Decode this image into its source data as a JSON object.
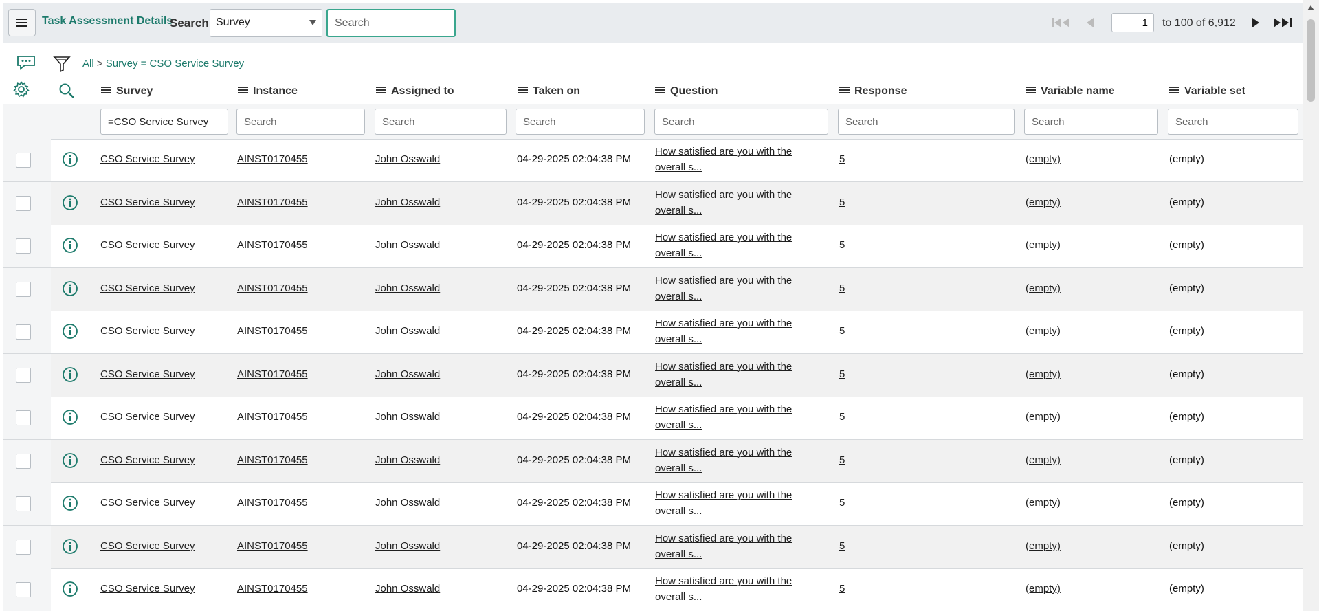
{
  "header": {
    "title": "Task Assessment Details",
    "search_label": "Search",
    "search_field": "Survey",
    "search_placeholder": "Search"
  },
  "pager": {
    "current_page": "1",
    "range_text": "to 100 of 6,912"
  },
  "breadcrumb": {
    "all": "All",
    "separator": ">",
    "condition": "Survey = CSO Service Survey"
  },
  "columns": [
    "Survey",
    "Instance",
    "Assigned to",
    "Taken on",
    "Question",
    "Response",
    "Variable name",
    "Variable set"
  ],
  "filters": [
    "=CSO Service Survey",
    "",
    "",
    "",
    "",
    "",
    "",
    ""
  ],
  "filter_placeholder": "Search",
  "rows": [
    {
      "survey": "CSO Service Survey",
      "instance": "AINST0170455",
      "assigned_to": "John Osswald",
      "taken_on": "04-29-2025 02:04:38 PM",
      "question": "How satisfied are you with the overall s...",
      "response": "5",
      "variable_name": "(empty)",
      "variable_set": "(empty)"
    },
    {
      "survey": "CSO Service Survey",
      "instance": "AINST0170455",
      "assigned_to": "John Osswald",
      "taken_on": "04-29-2025 02:04:38 PM",
      "question": "How satisfied are you with the overall s...",
      "response": "5",
      "variable_name": "(empty)",
      "variable_set": "(empty)"
    },
    {
      "survey": "CSO Service Survey",
      "instance": "AINST0170455",
      "assigned_to": "John Osswald",
      "taken_on": "04-29-2025 02:04:38 PM",
      "question": "How satisfied are you with the overall s...",
      "response": "5",
      "variable_name": "(empty)",
      "variable_set": "(empty)"
    },
    {
      "survey": "CSO Service Survey",
      "instance": "AINST0170455",
      "assigned_to": "John Osswald",
      "taken_on": "04-29-2025 02:04:38 PM",
      "question": "How satisfied are you with the overall s...",
      "response": "5",
      "variable_name": "(empty)",
      "variable_set": "(empty)"
    },
    {
      "survey": "CSO Service Survey",
      "instance": "AINST0170455",
      "assigned_to": "John Osswald",
      "taken_on": "04-29-2025 02:04:38 PM",
      "question": "How satisfied are you with the overall s...",
      "response": "5",
      "variable_name": "(empty)",
      "variable_set": "(empty)"
    },
    {
      "survey": "CSO Service Survey",
      "instance": "AINST0170455",
      "assigned_to": "John Osswald",
      "taken_on": "04-29-2025 02:04:38 PM",
      "question": "How satisfied are you with the overall s...",
      "response": "5",
      "variable_name": "(empty)",
      "variable_set": "(empty)"
    },
    {
      "survey": "CSO Service Survey",
      "instance": "AINST0170455",
      "assigned_to": "John Osswald",
      "taken_on": "04-29-2025 02:04:38 PM",
      "question": "How satisfied are you with the overall s...",
      "response": "5",
      "variable_name": "(empty)",
      "variable_set": "(empty)"
    },
    {
      "survey": "CSO Service Survey",
      "instance": "AINST0170455",
      "assigned_to": "John Osswald",
      "taken_on": "04-29-2025 02:04:38 PM",
      "question": "How satisfied are you with the overall s...",
      "response": "5",
      "variable_name": "(empty)",
      "variable_set": "(empty)"
    },
    {
      "survey": "CSO Service Survey",
      "instance": "AINST0170455",
      "assigned_to": "John Osswald",
      "taken_on": "04-29-2025 02:04:38 PM",
      "question": "How satisfied are you with the overall s...",
      "response": "5",
      "variable_name": "(empty)",
      "variable_set": "(empty)"
    },
    {
      "survey": "CSO Service Survey",
      "instance": "AINST0170455",
      "assigned_to": "John Osswald",
      "taken_on": "04-29-2025 02:04:38 PM",
      "question": "How satisfied are you with the overall s...",
      "response": "5",
      "variable_name": "(empty)",
      "variable_set": "(empty)"
    },
    {
      "survey": "CSO Service Survey",
      "instance": "AINST0170455",
      "assigned_to": "John Osswald",
      "taken_on": "04-29-2025 02:04:38 PM",
      "question": "How satisfied are you with the overall s...",
      "response": "5",
      "variable_name": "(empty)",
      "variable_set": "(empty)"
    }
  ],
  "colors": {
    "accent": "#1c7a6b",
    "focus_border": "#3aa68e",
    "header_bg": "#e9ecef"
  }
}
